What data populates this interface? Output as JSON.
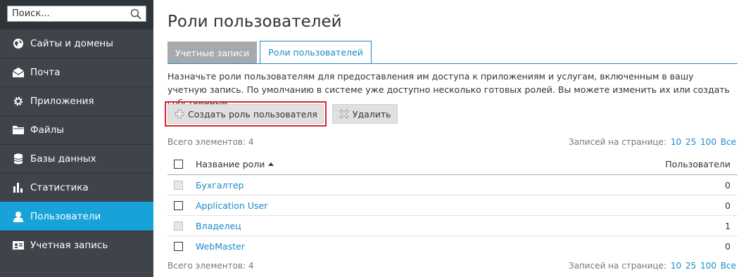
{
  "sidebar": {
    "search": {
      "placeholder": "Поиск...",
      "value": ""
    },
    "items": [
      {
        "label": "Сайты и домены",
        "icon": "globe-icon",
        "active": false
      },
      {
        "label": "Почта",
        "icon": "envelope-icon",
        "active": false
      },
      {
        "label": "Приложения",
        "icon": "gear-icon",
        "active": false
      },
      {
        "label": "Файлы",
        "icon": "folder-icon",
        "active": false
      },
      {
        "label": "Базы данных",
        "icon": "database-icon",
        "active": false
      },
      {
        "label": "Статистика",
        "icon": "bar-chart-icon",
        "active": false
      },
      {
        "label": "Пользователи",
        "icon": "user-icon",
        "active": true
      },
      {
        "label": "Учетная запись",
        "icon": "id-card-icon",
        "active": false
      }
    ]
  },
  "main": {
    "title": "Роли пользователей",
    "tabs": [
      {
        "label": "Учетные записи",
        "active": false
      },
      {
        "label": "Роли пользователей",
        "active": true
      }
    ],
    "description": "Назначьте роли пользователям для предоставления им доступа к приложениям и услугам, включенным в вашу учетную запись. По умолчанию в системе уже доступно несколько готовых ролей. Вы можете изменить их или создать собственные.",
    "toolbar": {
      "create_label": "Создать роль пользователя",
      "delete_label": "Удалить"
    },
    "pager_top": {
      "total_label": "Всего элементов: 4",
      "per_page_label": "Записей на странице:",
      "options": [
        "10",
        "25",
        "100",
        "Все"
      ]
    },
    "pager_bottom": {
      "total_label": "Всего элементов: 4",
      "per_page_label": "Записей на странице:",
      "options": [
        "10",
        "25",
        "100",
        "Все"
      ]
    },
    "table": {
      "columns": {
        "name": "Название роли",
        "users": "Пользователи"
      },
      "rows": [
        {
          "name": "Бухгалтер",
          "users": "0",
          "checkbox_enabled": false
        },
        {
          "name": "Application User",
          "users": "0",
          "checkbox_enabled": true
        },
        {
          "name": "Владелец",
          "users": "1",
          "checkbox_enabled": false
        },
        {
          "name": "WebMaster",
          "users": "0",
          "checkbox_enabled": true
        }
      ]
    }
  },
  "colors": {
    "sidebar_bg": "#3e4449",
    "active_nav": "#17a2d9",
    "link": "#1a8bc9",
    "highlight_border": "#d9242c"
  }
}
